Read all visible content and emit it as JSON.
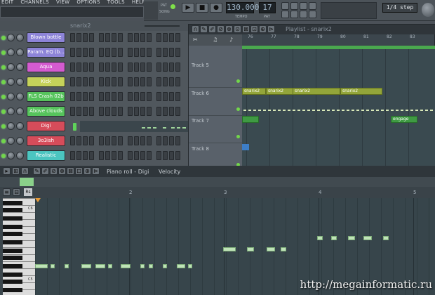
{
  "menu": [
    "EDIT",
    "CHANNELS",
    "VIEW",
    "OPTIONS",
    "TOOLS",
    "HELP"
  ],
  "transport": {
    "pat_label": "PAT",
    "song_label": "SONG",
    "tempo_value": "130.000",
    "tempo_label": "TEMPO",
    "pattern_value": "17",
    "pattern_label": "PAT",
    "snap_value": "1/4 step",
    "play_icon": "play-icon",
    "stop_icon": "stop-icon",
    "record_icon": "record-icon"
  },
  "channel_rack": {
    "title": "snarix2",
    "channels": [
      {
        "label": "Blown bottle",
        "color": "#8d84d8"
      },
      {
        "label": "Param. EQ (b...",
        "color": "#8d84d8"
      },
      {
        "label": "Aqua",
        "color": "#d45bd0"
      },
      {
        "label": "Kick",
        "color": "#c5d25a"
      },
      {
        "label": "FLS Crash 02b",
        "color": "#56c45c"
      },
      {
        "label": "Above clouds",
        "color": "#56c45c"
      },
      {
        "label": "Digi",
        "color": "#d64c5a"
      },
      {
        "label": "3o3ish",
        "color": "#d64c5a"
      },
      {
        "label": "Realistic",
        "color": "#4bc5c0"
      }
    ]
  },
  "playlist": {
    "title": "Playlist - snarix2",
    "ruler": [
      "76",
      "77",
      "78",
      "79",
      "80",
      "81",
      "82",
      "83"
    ],
    "tracks": [
      "Track 5",
      "Track 6",
      "Track 7",
      "Track 8"
    ],
    "patterns_track6": [
      "snarix2",
      "snarix2",
      "snarix2",
      "snarix2"
    ],
    "pattern_track7": "engage"
  },
  "piano_roll": {
    "title": "Piano roll - Digi",
    "mode": "Velocity",
    "bars": [
      "2",
      "3",
      "4",
      "5"
    ],
    "key_labels": [
      "C6",
      "C5"
    ]
  },
  "watermark": "http://megainformatic.ru"
}
